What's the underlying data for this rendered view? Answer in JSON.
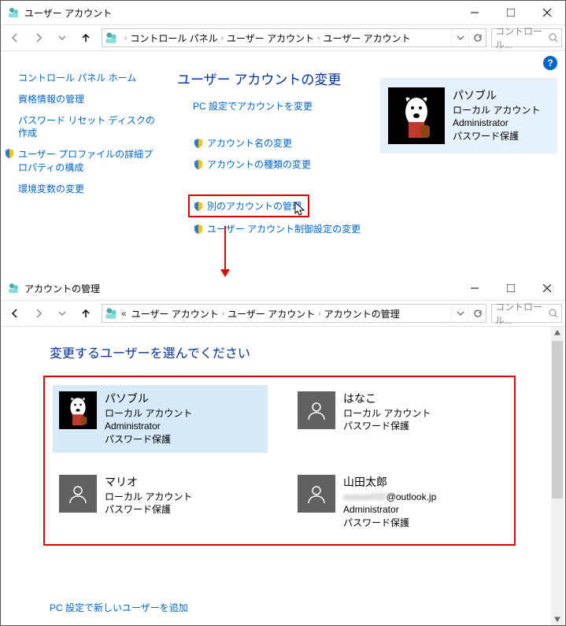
{
  "window1": {
    "title": "ユーザー アカウント",
    "breadcrumbs": [
      "コントロール パネル",
      "ユーザー アカウント",
      "ユーザー アカウント"
    ],
    "search_placeholder": "コントロール...",
    "left_links": {
      "home": "コントロール パネル ホーム",
      "cred": "資格情報の管理",
      "reset": "パスワード リセット ディスクの作成",
      "profile": "ユーザー プロファイルの詳細プロパティの構成",
      "env": "環境変数の変更"
    },
    "heading": "ユーザー アカウントの変更",
    "main_links": {
      "pc_settings": "PC 設定でアカウントを変更",
      "change_name": "アカウント名の変更",
      "change_type": "アカウントの種類の変更",
      "manage_other": "別のアカウントの管理",
      "uac": "ユーザー アカウント制御設定の変更"
    },
    "current_user": {
      "name": "パソブル",
      "type": "ローカル アカウント",
      "role": "Administrator",
      "pw": "パスワード保護"
    }
  },
  "window2": {
    "title": "アカウントの管理",
    "breadcrumbs_overflow": "«",
    "breadcrumbs": [
      "ユーザー アカウント",
      "ユーザー アカウント",
      "アカウントの管理"
    ],
    "search_placeholder": "コントロール...",
    "heading": "変更するユーザーを選んでください",
    "accounts": [
      {
        "name": "パソブル",
        "lines": [
          "ローカル アカウント",
          "Administrator",
          "パスワード保護"
        ],
        "avatar": "dog",
        "selected": true
      },
      {
        "name": "はなこ",
        "lines": [
          "ローカル アカウント",
          "パスワード保護"
        ],
        "avatar": "generic",
        "selected": false
      },
      {
        "name": "マリオ",
        "lines": [
          "ローカル アカウント",
          "パスワード保護"
        ],
        "avatar": "generic",
        "selected": false
      },
      {
        "name": "山田太郎",
        "lines": [
          "@outlook.jp",
          "Administrator",
          "パスワード保護"
        ],
        "email_blur": true,
        "avatar": "generic",
        "selected": false
      }
    ],
    "add_link": "PC 設定で新しいユーザーを追加"
  }
}
